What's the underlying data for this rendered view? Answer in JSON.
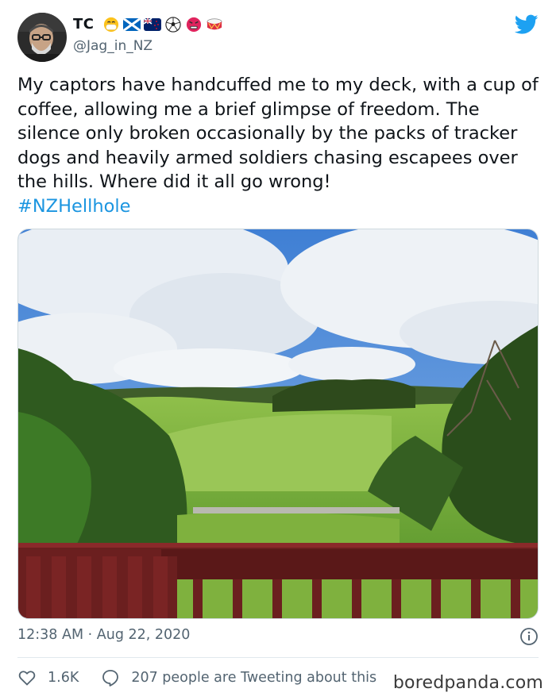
{
  "tweet": {
    "display_name": "TC",
    "name_emojis": [
      "face-with-mask-emoji",
      "scotland-flag-emoji",
      "new-zealand-flag-emoji",
      "soccer-ball-emoji",
      "angry-face-emoji",
      "drum-emoji"
    ],
    "handle": "@Jag_in_NZ",
    "text": "My captors have handcuffed me to my deck, with a cup of coffee, allowing me a brief glimpse of freedom. The silence only broken occasionally by the packs of tracker dogs and heavily armed soldiers chasing escapees over the hills. Where did it all go wrong!",
    "hashtag": "#NZHellhole",
    "photo_description": "deck-view-of-green-hills",
    "timestamp": "12:38 AM · Aug 22, 2020",
    "likes": "1.6K",
    "tweeting_about": "207 people are Tweeting about this"
  },
  "watermark": "boredpanda.com",
  "colors": {
    "link": "#1b95e0",
    "secondary_text": "#536471",
    "twitter_blue": "#1da1f2"
  }
}
